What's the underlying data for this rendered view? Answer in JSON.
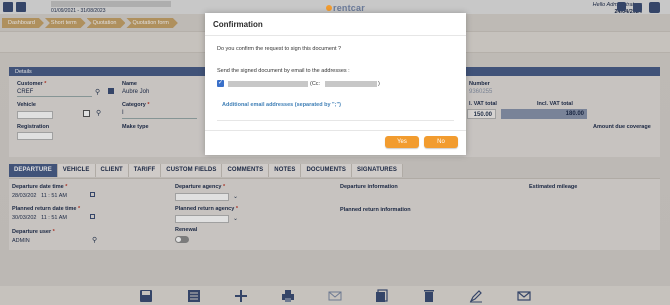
{
  "header": {
    "date_range": "01/09/2021 - 31/08/2023",
    "logo_text": "rentcar",
    "greeting": "Hello Administrateur",
    "date": "24/04/2024"
  },
  "breadcrumb": [
    "Dashboard",
    "Short term",
    "Quotation",
    "Quotation form"
  ],
  "details": {
    "title": "Details",
    "customer_label": "Customer",
    "customer_required": "*",
    "customer_value": "CREF",
    "name_label": "Name",
    "name_value": "Aubre Joh",
    "vehicle_label": "Vehicle",
    "category_label": "Category",
    "category_required": "*",
    "category_value": "I",
    "registration_label": "Registration",
    "make_type_label": "Make type",
    "number_label": "Number",
    "number_value": "9360255",
    "excl_vat_label": "l. VAT total",
    "excl_vat_value": "150.00",
    "incl_vat_label": "Incl. VAT total",
    "incl_vat_value": "180.00",
    "amount_due_label": "Amount due coverage"
  },
  "tabs": [
    "DEPARTURE",
    "VEHICLE",
    "CLIENT",
    "TARIFF",
    "CUSTOM FIELDS",
    "COMMENTS",
    "NOTES",
    "DOCUMENTS",
    "SIGNATURES"
  ],
  "departure": {
    "departure_time_label": "Departure date time",
    "departure_date": "28/03/202",
    "departure_hour": "11",
    "departure_min": "51",
    "departure_ampm": "AM",
    "planned_return_label": "Planned return date time",
    "return_date": "30/03/202",
    "return_hour": "11",
    "return_min": "51",
    "return_ampm": "AM",
    "departure_user_label": "Departure user",
    "departure_user_value": "ADMIN",
    "departure_agency_label": "Departure agency",
    "planned_return_agency_label": "Planned return agency",
    "renewal_label": "Renewal",
    "departure_info_label": "Departure information",
    "planned_return_info_label": "Planned return information",
    "estimated_mileage_label": "Estimated mileage",
    "required": "*"
  },
  "modal": {
    "title": "Confirmation",
    "question": "Do you confirm the request to sign this document ?",
    "send_text": "Send the signed document by email to the addresses :",
    "cc_label": "(Cc:",
    "cc_close": ")",
    "additional_link": "Additional email addresses (separated by \";\")",
    "yes_label": "Yes",
    "no_label": "No"
  },
  "colors": {
    "accent": "#f29c2f",
    "nav": "#4b5f8a",
    "breadcrumb": "#c8a46a"
  }
}
